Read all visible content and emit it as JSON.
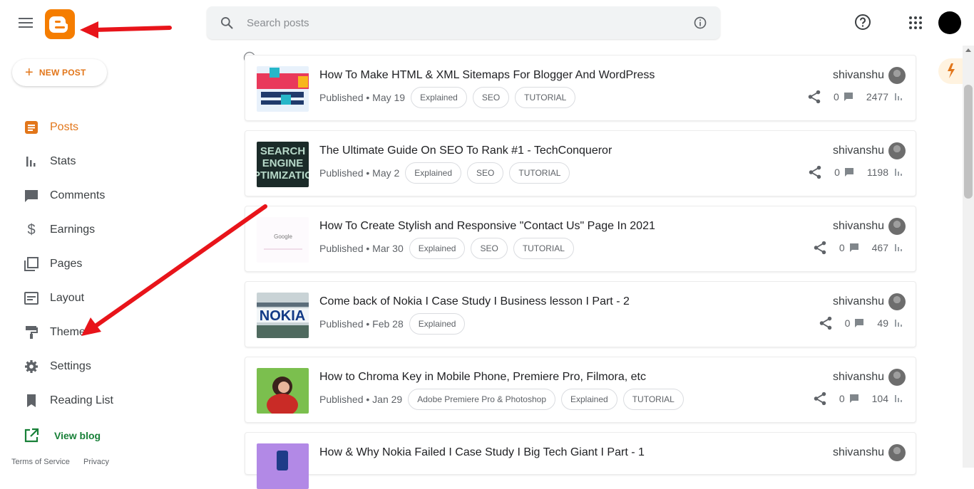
{
  "header": {
    "search_placeholder": "Search posts"
  },
  "sidebar": {
    "new_post": "NEW POST",
    "items": [
      {
        "label": "Posts",
        "icon": "posts-icon"
      },
      {
        "label": "Stats",
        "icon": "stats-icon"
      },
      {
        "label": "Comments",
        "icon": "comments-icon"
      },
      {
        "label": "Earnings",
        "icon": "earnings-icon"
      },
      {
        "label": "Pages",
        "icon": "pages-icon"
      },
      {
        "label": "Layout",
        "icon": "layout-icon"
      },
      {
        "label": "Theme",
        "icon": "theme-icon"
      },
      {
        "label": "Settings",
        "icon": "settings-icon"
      },
      {
        "label": "Reading List",
        "icon": "reading-list-icon"
      }
    ],
    "view_blog": "View blog",
    "footer": {
      "terms": "Terms of Service",
      "privacy": "Privacy"
    }
  },
  "posts": [
    {
      "title": "How To Make HTML & XML Sitemaps For Blogger And WordPress",
      "status": "Published • May 19",
      "labels": [
        "Explained",
        "SEO",
        "TUTORIAL"
      ],
      "author": "shivanshu",
      "comments": "0",
      "views": "2477"
    },
    {
      "title": "The Ultimate Guide On SEO To Rank #1 - TechConqueror",
      "status": "Published • May 2",
      "labels": [
        "Explained",
        "SEO",
        "TUTORIAL"
      ],
      "author": "shivanshu",
      "comments": "0",
      "views": "1198"
    },
    {
      "title": "How To Create Stylish and Responsive \"Contact Us\" Page In 2021",
      "status": "Published • Mar 30",
      "labels": [
        "Explained",
        "SEO",
        "TUTORIAL"
      ],
      "author": "shivanshu",
      "comments": "0",
      "views": "467"
    },
    {
      "title": "Come back of Nokia I Case Study I Business lesson I Part - 2",
      "status": "Published • Feb 28",
      "labels": [
        "Explained"
      ],
      "author": "shivanshu",
      "comments": "0",
      "views": "49"
    },
    {
      "title": "How to Chroma Key in Mobile Phone, Premiere Pro, Filmora, etc",
      "status": "Published • Jan 29",
      "labels": [
        "Adobe Premiere Pro & Photoshop",
        "Explained",
        "TUTORIAL"
      ],
      "author": "shivanshu",
      "comments": "0",
      "views": "104"
    },
    {
      "title": "How & Why Nokia Failed I Case Study I Big Tech Giant I Part - 1",
      "status": "",
      "labels": [],
      "author": "shivanshu",
      "comments": "",
      "views": ""
    }
  ],
  "thumb_texts": {
    "seo": "SEARCH ENGINE OPTIMIZATION",
    "google": "Google",
    "nokia": "NOKIA"
  },
  "colors": {
    "accent": "#e2761a",
    "blogger_logo": "#f57d00",
    "view_blog": "#188038",
    "annotation_arrow": "#e8141a"
  }
}
